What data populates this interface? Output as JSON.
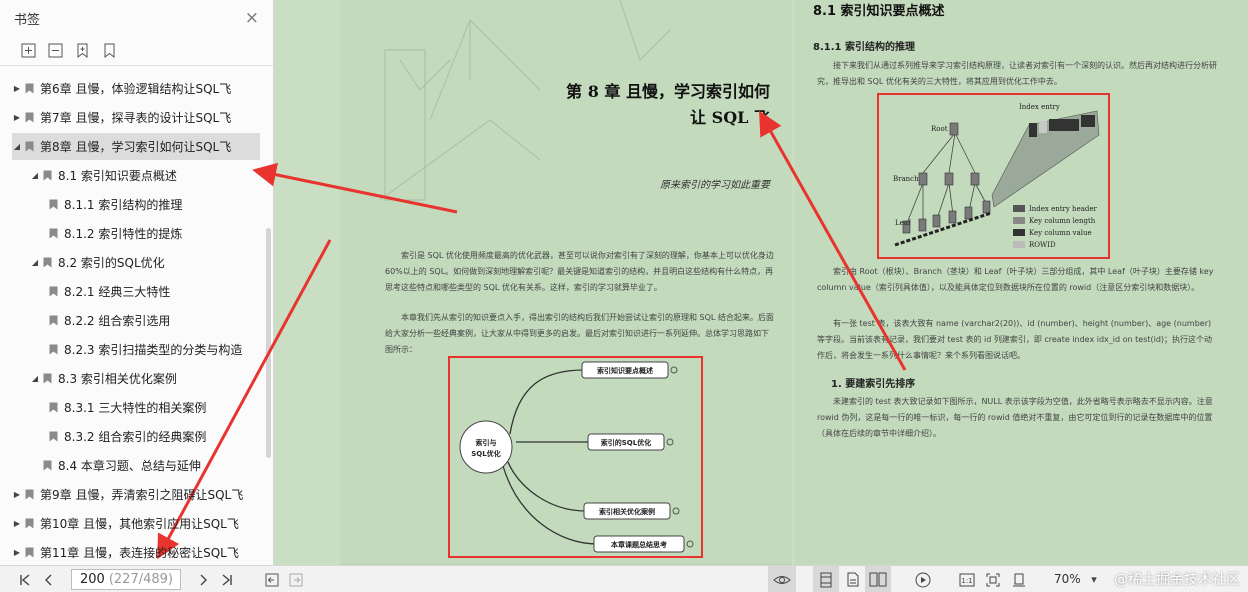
{
  "sidebar": {
    "title": "书签",
    "close_glyph": "×",
    "tools": [
      "expand-all-icon",
      "collapse-all-icon",
      "add-bookmark-icon",
      "bookmark-icon"
    ],
    "items": [
      {
        "label": "第6章 且慢，体验逻辑结构让SQL飞",
        "level": 0,
        "arrow": "▶"
      },
      {
        "label": "第7章 且慢，探寻表的设计让SQL飞",
        "level": 0,
        "arrow": "▶"
      },
      {
        "label": "第8章 且慢，学习索引如何让SQL飞",
        "level": 0,
        "arrow": "◢",
        "selected": true
      },
      {
        "label": "8.1 索引知识要点概述",
        "level": 1,
        "arrow": "◢"
      },
      {
        "label": "8.1.1 索引结构的推理",
        "level": 2,
        "arrow": ""
      },
      {
        "label": "8.1.2 索引特性的提炼",
        "level": 2,
        "arrow": ""
      },
      {
        "label": "8.2 索引的SQL优化",
        "level": 1,
        "arrow": "◢"
      },
      {
        "label": "8.2.1 经典三大特性",
        "level": 2,
        "arrow": ""
      },
      {
        "label": "8.2.2 组合索引选用",
        "level": 2,
        "arrow": ""
      },
      {
        "label": "8.2.3 索引扫描类型的分类与构造",
        "level": 2,
        "arrow": ""
      },
      {
        "label": "8.3 索引相关优化案例",
        "level": 1,
        "arrow": "◢"
      },
      {
        "label": "8.3.1 三大特性的相关案例",
        "level": 2,
        "arrow": ""
      },
      {
        "label": "8.3.2 组合索引的经典案例",
        "level": 2,
        "arrow": ""
      },
      {
        "label": "8.4 本章习题、总结与延伸",
        "level": 1,
        "arrow": ""
      },
      {
        "label": "第9章 且慢，弄清索引之阻碍让SQL飞",
        "level": 0,
        "arrow": "▶"
      },
      {
        "label": "第10章 且慢，其他索引应用让SQL飞",
        "level": 0,
        "arrow": "▶"
      },
      {
        "label": "第11章 且慢，表连接的秘密让SQL飞",
        "level": 0,
        "arrow": "▶"
      }
    ]
  },
  "left_page": {
    "chapter_line1": "第 8 章    且慢，学习索引如何",
    "chapter_line2": "让 SQL 飞",
    "motto": "原来索引的学习如此重要",
    "para1": "索引是 SQL 优化使用频度最高的优化武器，甚至可以说你对索引有了深刻的理解，你基本上可以优化身边 60%以上的 SQL。如何做到深刻地理解索引呢？最关键是知道索引的结构，并且明白这些结构有什么特点，再思考这些特点和哪些类型的 SQL 优化有关系。这样，索引的学习就算毕业了。",
    "para2": "本章我们先从索引的知识要点入手，得出索引的结构后我们开始尝试让索引的原理和 SQL 结合起来。后面给大家分析一些经典案例，让大家从中得到更多的启发。最后对索引知识进行一系列延伸。总体学习思路如下图所示：",
    "mindmap": {
      "center": [
        "索引与",
        "SQL优化"
      ],
      "branches": [
        "索引知识要点概述",
        "索引的SQL优化",
        "索引相关优化案例",
        "本章课题总结思考"
      ]
    }
  },
  "right_page": {
    "section": "8.1    索引知识要点概述",
    "subsection": "8.1.1    索引结构的推理",
    "intro": "接下来我们从通过系列推导来学习索引结构原理，让读者对索引有一个深刻的认识。然后再对结构进行分析研究，推导出和 SQL 优化有关的三大特性，将其应用到优化工作中去。",
    "figure": {
      "index_entry": "Index entry",
      "root": "Root",
      "branch": "Branch",
      "leaf": "Leaf",
      "legend": [
        "Index entry header",
        "Key column length",
        "Key column value",
        "ROWID"
      ]
    },
    "para1": "索引由 Root（根块）、Branch（茎块）和 Leaf（叶子块）三部分组成，其中 Leaf（叶子块）主要存储 key column value（索引列具体值），以及能具体定位到数据块所在位置的 rowid（注意区分索引块和数据块）。",
    "para2": "有一张 test 表，该表大致有 name (varchar2(20))、id (number)、height (number)、age (number)等字段。当前该表有记录，我们要对 test 表的 id 列建索引，即 create index idx_id on test(id)；执行这个动作后，将会发生一系列什么事情呢？来个系列看图说话吧。",
    "h3": "1. 要建索引先排序",
    "para3": "未建索引的 test 表大致记录如下图所示，NULL 表示该字段为空值，此外省略号表示略去不显示内容。注意 rowid 伪列，这是每一行的唯一标识，每一行的 rowid 值绝对不重复，由它可定位到行的记录在数据库中的位置（具体在后续的章节中详细介绍）。"
  },
  "bottombar": {
    "page_current": "200",
    "page_total": "(227/489)",
    "zoom": "70%",
    "watermark": "@稀土掘金技术社区"
  },
  "colors": {
    "annotation_red": "#e8332f",
    "page_bg": "#c3dabd"
  }
}
